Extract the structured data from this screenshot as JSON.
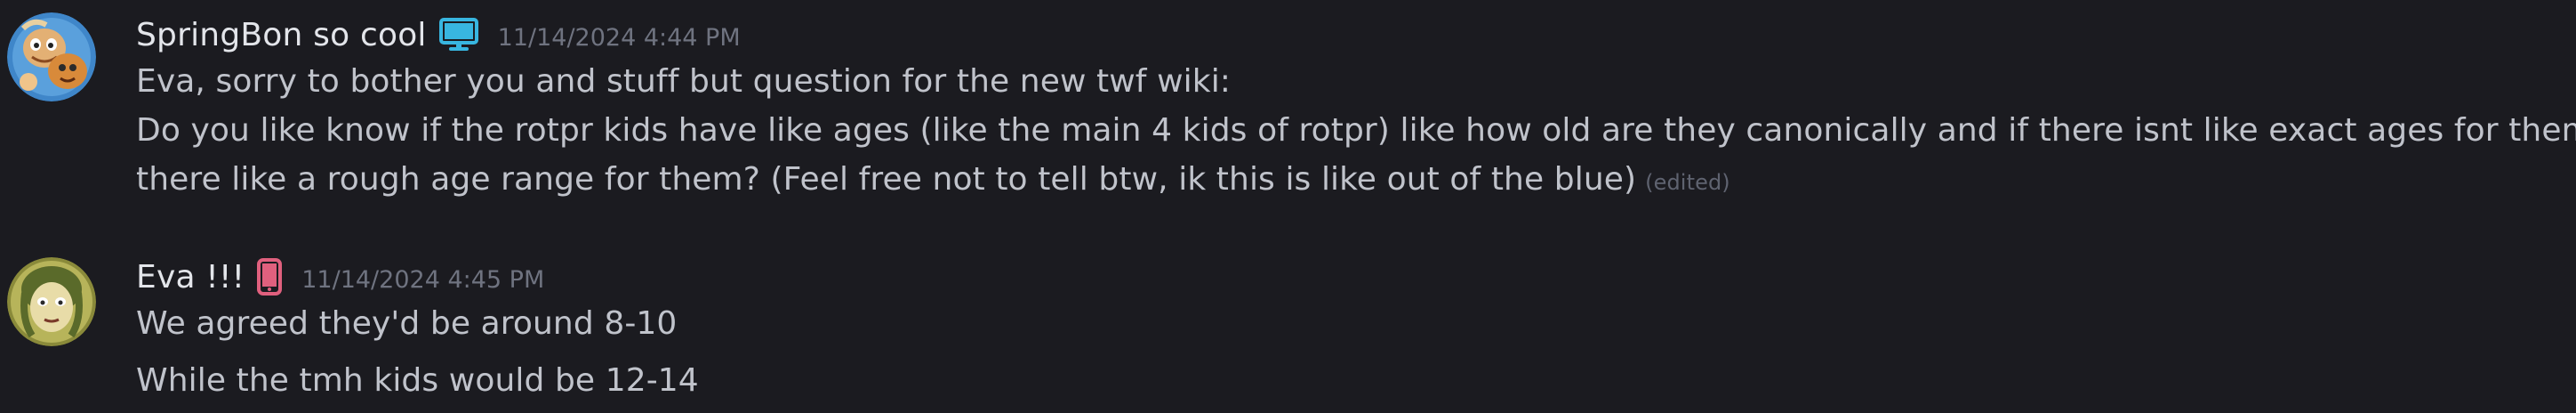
{
  "messages": [
    {
      "author": "SpringBon so cool",
      "device": "desktop-icon",
      "device_color": "#38b6e0",
      "timestamp": "11/14/2024 4:44 PM",
      "lines": [
        "Eva, sorry to bother you and stuff but question for the new twf wiki:",
        "Do you like know if the rotpr kids have like ages (like the main 4 kids of rotpr) like how old are they canonically and if there isnt like exact ages for them, is",
        "there like a rough age range for them? (Feel free not to tell btw, ik this is like out of the blue)"
      ],
      "edited_label": "(edited)"
    },
    {
      "author": "Eva !!!",
      "device": "mobile-icon",
      "device_color": "#e0607e",
      "timestamp": "11/14/2024 4:45 PM",
      "lines": [
        "We agreed they'd be around 8-10",
        "While the tmh kids would be 12-14"
      ]
    }
  ]
}
